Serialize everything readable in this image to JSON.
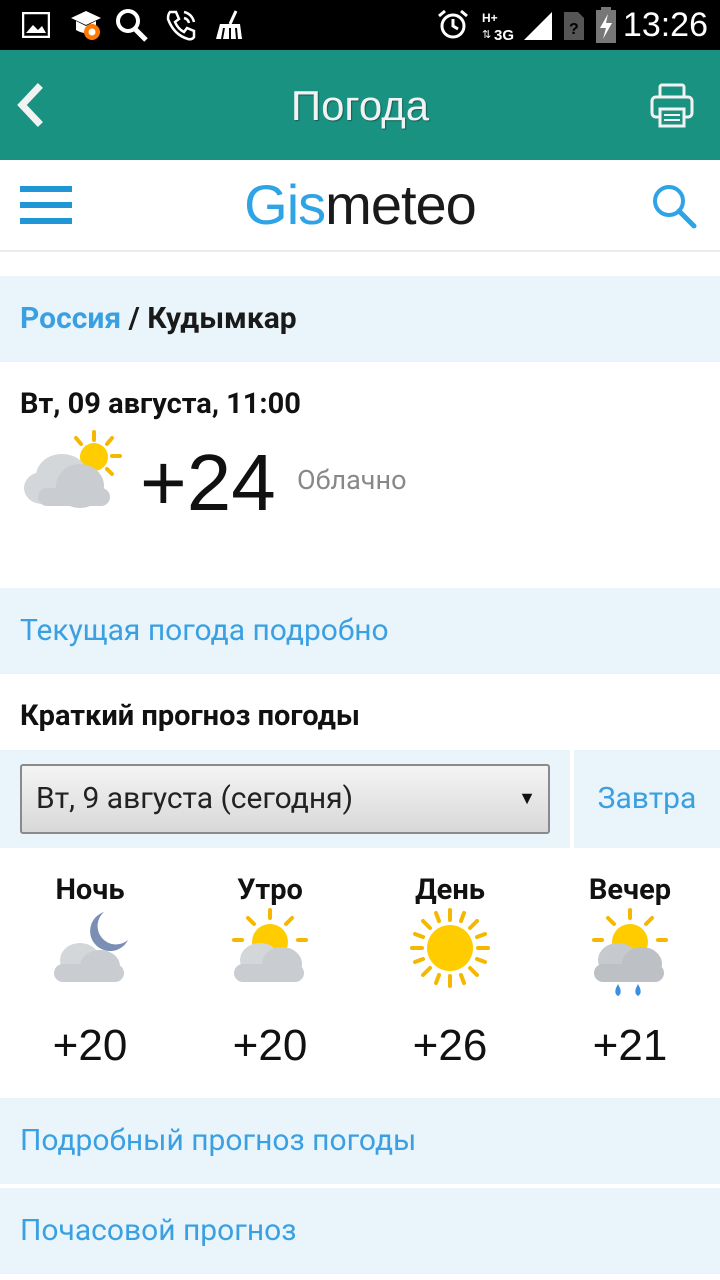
{
  "status_bar": {
    "time": "13:26",
    "network": "3G",
    "icons": [
      "image-icon",
      "app-notification-icon",
      "search-icon",
      "call-icon",
      "cleaner-icon",
      "alarm-icon",
      "network-hplus-icon",
      "signal-icon",
      "sim-unknown-icon",
      "battery-charging-icon"
    ]
  },
  "app_bar": {
    "title": "Погода",
    "back_icon": "chevron-left-icon",
    "print_icon": "printer-icon",
    "color": "#1a9281"
  },
  "site_header": {
    "logo_part1": "Gis",
    "logo_part2": "meteo",
    "menu_icon": "hamburger-menu-icon",
    "search_icon": "search-icon",
    "accent": "#2ea3e6"
  },
  "breadcrumb": {
    "country": "Россия",
    "separator": "/",
    "city": "Кудымкар"
  },
  "current": {
    "datetime": "Вт, 09 августа, 11:00",
    "icon": "partly-cloudy-sun-icon",
    "temperature": "+24",
    "condition": "Облачно"
  },
  "links": {
    "current_detail": "Текущая погода подробно",
    "detailed_forecast": "Подробный прогноз погоды",
    "hourly_forecast": "Почасовой прогноз"
  },
  "short_forecast": {
    "title": "Краткий прогноз погоды",
    "selected_day": "Вт, 9 августа (сегодня)",
    "caret": "▼",
    "tomorrow_label": "Завтра",
    "periods": [
      {
        "label": "Ночь",
        "icon": "cloud-moon-icon",
        "temp": "+20"
      },
      {
        "label": "Утро",
        "icon": "cloud-sun-icon",
        "temp": "+20"
      },
      {
        "label": "День",
        "icon": "sun-icon",
        "temp": "+26"
      },
      {
        "label": "Вечер",
        "icon": "cloud-sun-rain-icon",
        "temp": "+21"
      }
    ]
  }
}
